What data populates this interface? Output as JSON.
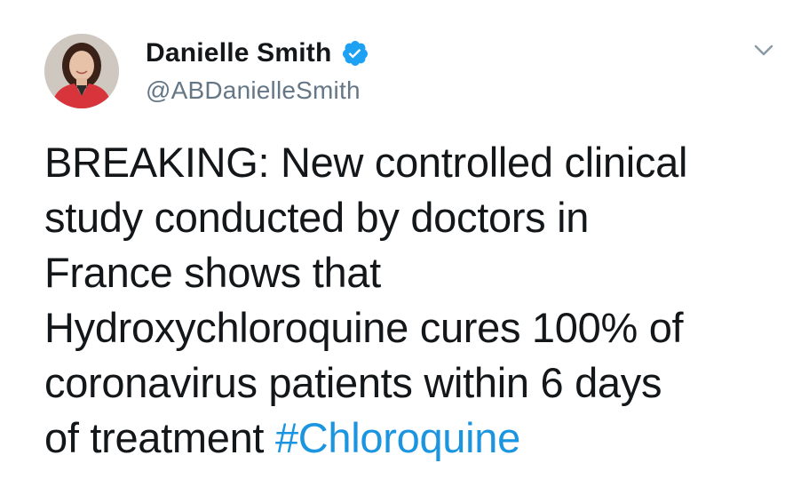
{
  "author": {
    "display_name": "Danielle Smith",
    "handle": "@ABDanielleSmith",
    "verified": true
  },
  "icons": {
    "verified": "verified-badge-icon",
    "menu": "chevron-down-icon"
  },
  "tweet": {
    "lines": [
      "BREAKING: New controlled clinical",
      "study conducted by doctors in",
      "France shows that",
      "Hydroxychloroquine cures 100% of",
      "coronavirus patients within 6 days",
      "of treatment "
    ],
    "hashtag": "#Chloroquine"
  },
  "colors": {
    "text": "#14171a",
    "secondary": "#657786",
    "link": "#1b95e0",
    "verified": "#1da1f2"
  }
}
